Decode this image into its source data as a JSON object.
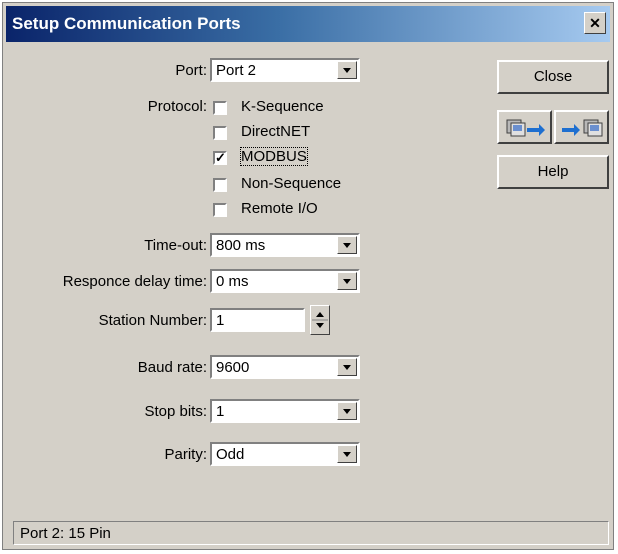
{
  "window": {
    "title": "Setup Communication Ports",
    "close_glyph": "✕"
  },
  "port": {
    "label": "Port:",
    "value": "Port 2"
  },
  "protocol": {
    "label": "Protocol:",
    "options": [
      {
        "label": "K-Sequence",
        "checked": false
      },
      {
        "label": "DirectNET",
        "checked": false
      },
      {
        "label": "MODBUS",
        "checked": true
      },
      {
        "label": "Non-Sequence",
        "checked": false
      },
      {
        "label": "Remote I/O",
        "checked": false
      }
    ]
  },
  "timeout": {
    "label": "Time-out:",
    "value": "800 ms"
  },
  "response_delay": {
    "label": "Responce delay time:",
    "value": "0 ms"
  },
  "station_number": {
    "label": "Station Number:",
    "value": "1"
  },
  "baud_rate": {
    "label": "Baud rate:",
    "value": "9600"
  },
  "stop_bits": {
    "label": "Stop bits:",
    "value": "1"
  },
  "parity": {
    "label": "Parity:",
    "value": "Odd"
  },
  "buttons": {
    "close": "Close",
    "help": "Help",
    "read_icon": "pc-read-icon",
    "write_icon": "pc-write-icon"
  },
  "status": {
    "text": "Port 2: 15 Pin"
  }
}
